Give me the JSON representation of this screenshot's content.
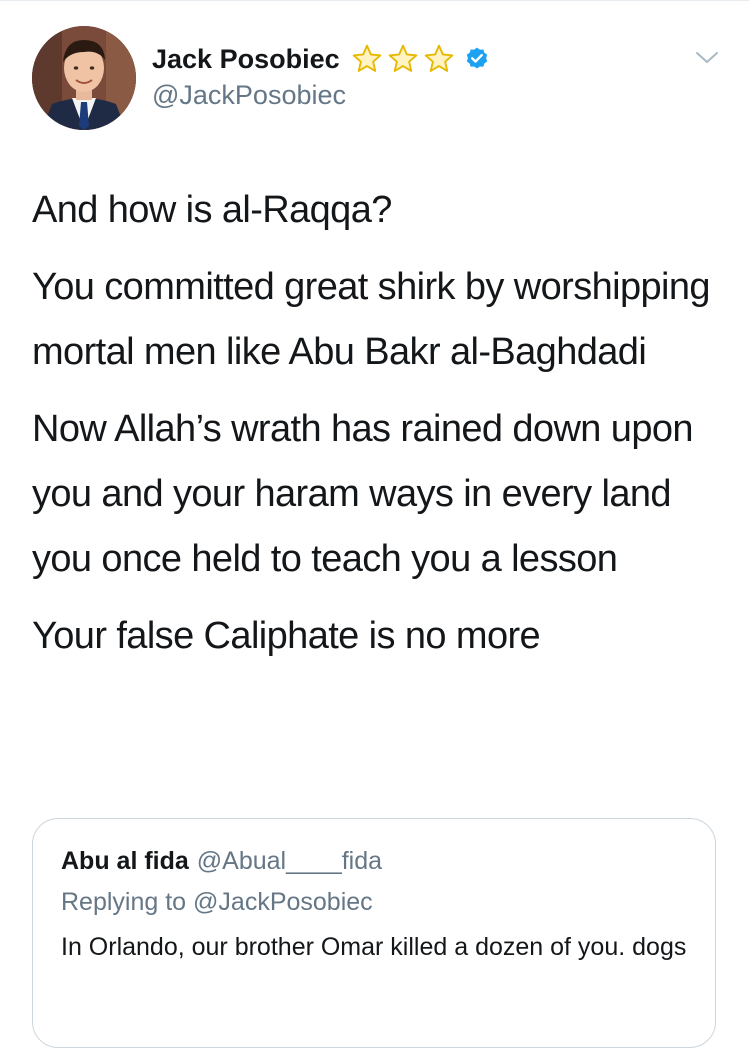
{
  "tweet": {
    "author": {
      "display_name": "Jack Posobiec",
      "handle": "@JackPosobiec",
      "badges": [
        "star-icon",
        "star-icon",
        "star-icon",
        "verified-badge-icon"
      ],
      "avatar_icon": "profile-photo"
    },
    "menu_icon": "chevron-down-icon",
    "paragraphs": [
      "And how is al-Raqqa?",
      "You committed great shirk by worshipping mortal men like Abu Bakr al-Baghdadi",
      "Now Allah’s wrath has rained down upon you and your haram ways in every land you once held to teach you a lesson",
      "Your false Caliphate is no more"
    ],
    "quoted_tweet": {
      "display_name": "Abu al fida",
      "handle": "@Abual____fida",
      "replying_prefix": "Replying to",
      "replying_to": "@JackPosobiec",
      "text": "In Orlando, our brother Omar killed a dozen of you. dogs"
    }
  },
  "colors": {
    "text_primary": "#14171a",
    "text_secondary": "#657786",
    "verified_blue": "#1da1f2",
    "star_gold": "#f5c518",
    "border": "#ccd6dd"
  }
}
